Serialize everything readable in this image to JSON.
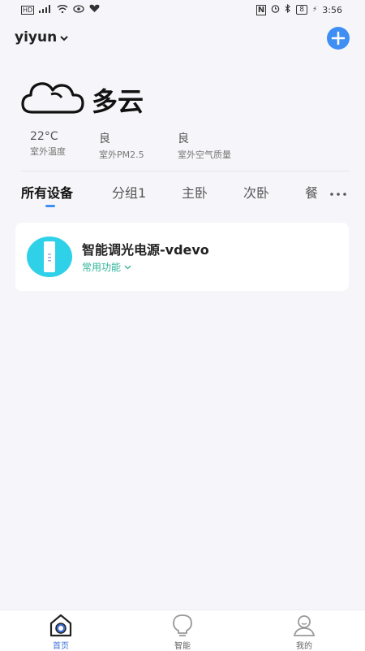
{
  "status_bar": {
    "left_icons": [
      "hd-icon",
      "signal-icon",
      "wifi-icon",
      "eye-icon",
      "heart-icon"
    ],
    "battery": "8",
    "time": "3:56"
  },
  "header": {
    "home_name": "yiyun"
  },
  "weather": {
    "condition": "多云",
    "stats": [
      {
        "value": "22°C",
        "label": "室外温度"
      },
      {
        "value": "良",
        "label": "室外PM2.5"
      },
      {
        "value": "良",
        "label": "室外空气质量"
      }
    ]
  },
  "tabs": [
    {
      "label": "所有设备",
      "active": true
    },
    {
      "label": "分组1"
    },
    {
      "label": "主卧"
    },
    {
      "label": "次卧"
    },
    {
      "label": "餐"
    }
  ],
  "colors": {
    "accent": "#3f8ef3",
    "device_icon": "#2fd1e8",
    "function_link": "#2fb59a"
  },
  "devices": [
    {
      "name": "智能调光电源-vdevo",
      "function_label": "常用功能"
    }
  ],
  "bottom_nav": [
    {
      "label": "首页",
      "icon": "home-icon",
      "active": true
    },
    {
      "label": "智能",
      "icon": "bulb-icon"
    },
    {
      "label": "我的",
      "icon": "profile-icon"
    }
  ]
}
